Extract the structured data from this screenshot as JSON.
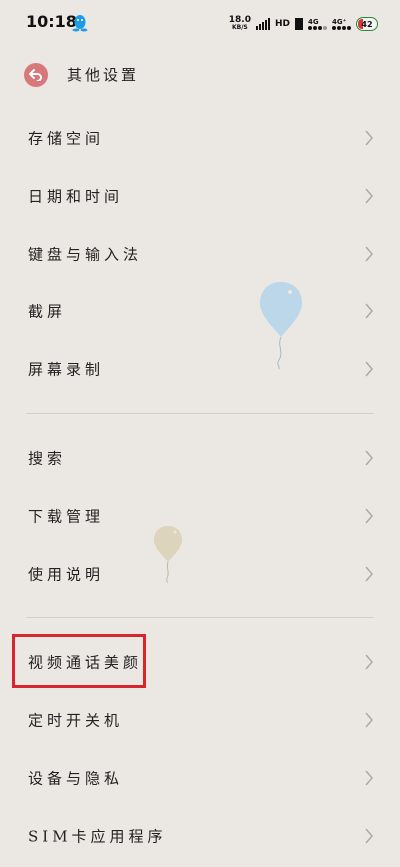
{
  "status_bar": {
    "time": "10:18",
    "net_speed_value": "18.0",
    "net_speed_unit": "KB/S",
    "hd": "HD",
    "sim1": "4G",
    "sim2": "4G⁺",
    "battery": "42"
  },
  "header": {
    "title": "其他设置"
  },
  "groups": [
    {
      "items": [
        {
          "label": "存储空间"
        },
        {
          "label": "日期和时间"
        },
        {
          "label": "键盘与输入法"
        },
        {
          "label": "截屏"
        },
        {
          "label": "屏幕录制"
        }
      ]
    },
    {
      "items": [
        {
          "label": "搜索"
        },
        {
          "label": "下载管理"
        },
        {
          "label": "使用说明"
        }
      ]
    },
    {
      "items": [
        {
          "label": "视频通话美颜"
        },
        {
          "label": "定时开关机"
        },
        {
          "label": "设备与隐私"
        },
        {
          "label": "SIM卡应用程序"
        }
      ]
    }
  ],
  "colors": {
    "background": "#ebe8e3",
    "back_button": "#d7787a",
    "highlight": "#d8262f",
    "qq_icon": "#1e9be8"
  }
}
